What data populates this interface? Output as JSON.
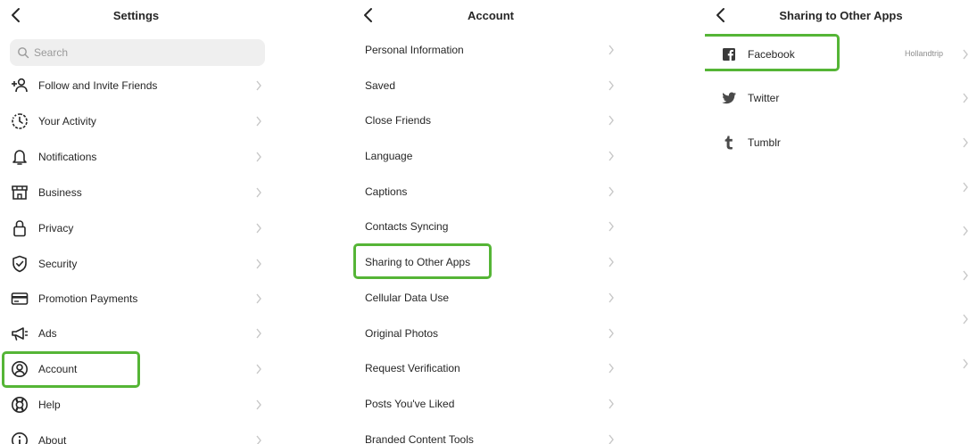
{
  "settings": {
    "title": "Settings",
    "search_placeholder": "Search",
    "items": [
      {
        "label": "Follow and Invite Friends",
        "icon": "add-person-icon"
      },
      {
        "label": "Your Activity",
        "icon": "activity-icon"
      },
      {
        "label": "Notifications",
        "icon": "bell-icon"
      },
      {
        "label": "Business",
        "icon": "shop-icon"
      },
      {
        "label": "Privacy",
        "icon": "lock-icon"
      },
      {
        "label": "Security",
        "icon": "shield-check-icon"
      },
      {
        "label": "Promotion Payments",
        "icon": "card-icon"
      },
      {
        "label": "Ads",
        "icon": "megaphone-icon"
      },
      {
        "label": "Account",
        "icon": "account-circle-icon"
      },
      {
        "label": "Help",
        "icon": "lifebuoy-icon"
      },
      {
        "label": "About",
        "icon": "info-icon"
      }
    ]
  },
  "account": {
    "title": "Account",
    "items": [
      {
        "label": "Personal Information"
      },
      {
        "label": "Saved"
      },
      {
        "label": "Close Friends"
      },
      {
        "label": "Language"
      },
      {
        "label": "Captions"
      },
      {
        "label": "Contacts Syncing"
      },
      {
        "label": "Sharing to Other Apps"
      },
      {
        "label": "Cellular Data Use"
      },
      {
        "label": "Original Photos"
      },
      {
        "label": "Request Verification"
      },
      {
        "label": "Posts You've Liked"
      },
      {
        "label": "Branded Content Tools"
      }
    ]
  },
  "sharing": {
    "title": "Sharing to Other Apps",
    "items": [
      {
        "label": "Facebook",
        "icon": "facebook-icon",
        "value": "Hollandtrip"
      },
      {
        "label": "Twitter",
        "icon": "twitter-icon"
      },
      {
        "label": "Tumblr",
        "icon": "tumblr-icon"
      }
    ]
  },
  "colors": {
    "highlight": "#55b536",
    "text": "#262626",
    "muted": "#8e8e8e",
    "search_bg": "#efefef"
  }
}
